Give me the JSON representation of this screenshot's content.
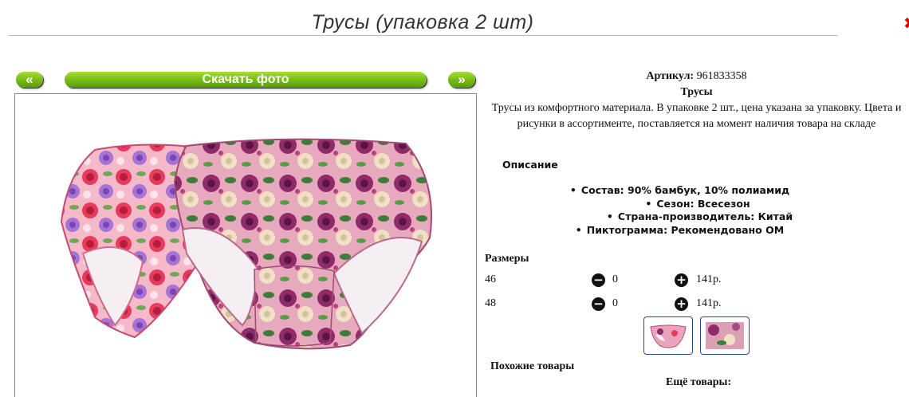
{
  "header": {
    "title": "Трусы (упаковка 2 шт)"
  },
  "gallery": {
    "prev_label": "«",
    "download_label": "Скачать фото",
    "next_label": "»"
  },
  "product": {
    "article_label": "Артикул:",
    "article_value": "961833358",
    "name": "Трусы",
    "description": "Трусы из комфортного материала. В упаковке 2 шт., цена указана за упаковку. Цвета и рисунки в ассортименте, поставляется на момент наличия товара на складе",
    "spec_heading": "Описание",
    "specs": [
      "Состав: 90% бамбук, 10% полиамид",
      "Сезон: Всесезон",
      "Страна-производитель: Китай",
      "Пиктограмма: Рекомендовано ОМ"
    ]
  },
  "sizes": {
    "heading": "Размеры",
    "rows": [
      {
        "size": "46",
        "qty": "0",
        "price": "141р."
      },
      {
        "size": "48",
        "qty": "0",
        "price": "141р."
      }
    ]
  },
  "related": {
    "similar_label": "Похожие товары",
    "more_label": "Ещё товары:"
  },
  "colors": {
    "button_green": "#7cc018",
    "thumb_border": "#2b4a8a",
    "title_rule": "#bbbbbb"
  }
}
